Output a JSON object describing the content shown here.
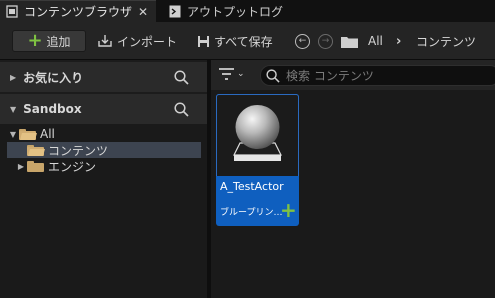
{
  "tabs": [
    {
      "label": "コンテンツブラウザ",
      "active": true
    },
    {
      "label": "アウトプットログ",
      "active": false
    }
  ],
  "toolbar": {
    "add_label": "追加",
    "import_label": "インポート",
    "save_all_label": "すべて保存"
  },
  "breadcrumb": [
    "All",
    "コンテンツ"
  ],
  "left_panel": {
    "favorites_label": "お気に入り",
    "project_label": "Sandbox",
    "tree": [
      {
        "label": "All",
        "expanded": true,
        "selected": false
      },
      {
        "label": "コンテンツ",
        "expanded": false,
        "selected": true
      },
      {
        "label": "エンジン",
        "expanded": false,
        "selected": false
      }
    ]
  },
  "content": {
    "search_placeholder": "検索 コンテンツ",
    "assets": [
      {
        "name": "A_TestActor",
        "type": "ブループリン…"
      }
    ]
  },
  "colors": {
    "accent_blue": "#0f5fbf",
    "plus_green": "#7fc242",
    "selection": "#3d4450",
    "folder": "#c8a56a"
  }
}
